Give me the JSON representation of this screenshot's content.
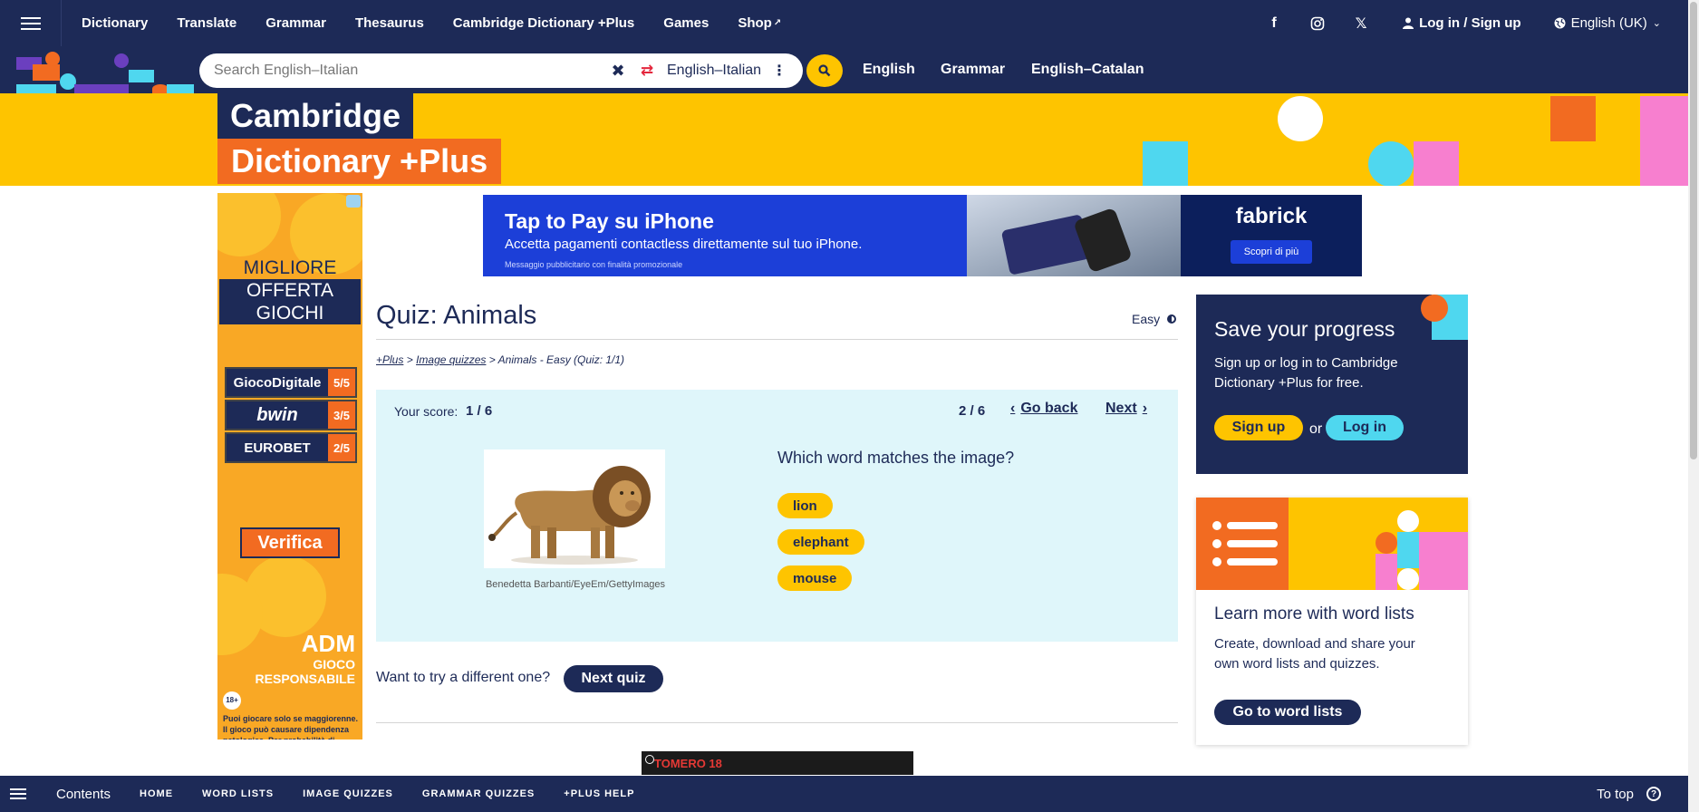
{
  "topnav": {
    "links": [
      "Dictionary",
      "Translate",
      "Grammar",
      "Thesaurus",
      "Cambridge Dictionary +Plus",
      "Games",
      "Shop"
    ],
    "login": "Log in / Sign up",
    "language": "English (UK)"
  },
  "search": {
    "placeholder": "Search English–Italian",
    "dictionary": "English–Italian",
    "quick_links": [
      "English",
      "Grammar",
      "English–Catalan"
    ]
  },
  "banner": {
    "line1": "Cambridge",
    "line2": "Dictionary +Plus"
  },
  "left_ad": {
    "title": [
      "MIGLIORE",
      "OFFERTA",
      "GIOCHI"
    ],
    "rows": [
      {
        "name": "GiocoDigitale",
        "score": "5/5"
      },
      {
        "name": "bwin",
        "score": "3/5"
      },
      {
        "name": "EUROBET",
        "score": "2/5"
      }
    ],
    "cta": "Verifica",
    "adm": "ADM",
    "gioco": "GIOCO RESPONSABILE",
    "age": "18+",
    "disclaimer": "Puoi giocare solo se maggiorenne. Il gioco può causare dipendenza patologica. Per probabilità di vincita vai su www.adm.gov.it o www.eurobet.it"
  },
  "top_ad": {
    "headline": "Tap to Pay su iPhone",
    "sub": "Accetta pagamenti contactless direttamente sul tuo iPhone.",
    "fine": "Messaggio pubblicitario con finalità promozionale",
    "brand": "fabrick",
    "cta": "Scopri di più"
  },
  "quiz": {
    "title": "Quiz: Animals",
    "difficulty": "Easy",
    "breadcrumb": {
      "plus": "+Plus",
      "sep": ">",
      "image_quizzes": "Image quizzes",
      "current": "> Animals - Easy (Quiz: 1/1)"
    },
    "score_label": "Your score:",
    "score": "1 / 6",
    "progress": "2 / 6",
    "go_back": "Go back",
    "next": "Next",
    "image_credit": "Benedetta Barbanti/EyeEm/GettyImages",
    "question": "Which word matches the image?",
    "answers": [
      "lion",
      "elephant",
      "mouse"
    ],
    "try_text": "Want to try a different one?",
    "next_quiz": "Next quiz"
  },
  "bottom_ad": {
    "text": "TOMERO 18"
  },
  "save_panel": {
    "title": "Save your progress",
    "text": "Sign up or log in to Cambridge Dictionary +Plus for free.",
    "signup": "Sign up",
    "or": "or",
    "login": "Log in"
  },
  "lists_panel": {
    "title": "Learn more with word lists",
    "text": "Create, download and share your own word lists and quizzes.",
    "button": "Go to word lists"
  },
  "bottombar": {
    "contents": "Contents",
    "links": [
      "HOME",
      "WORD LISTS",
      "IMAGE QUIZZES",
      "GRAMMAR QUIZZES",
      "+PLUS HELP"
    ],
    "to_top": "To top"
  },
  "colors": {
    "navy": "#1d2a57",
    "yellow": "#fec400",
    "orange": "#f26b21",
    "cyan": "#4fd7ef",
    "quiz_bg": "#dff6fa"
  }
}
